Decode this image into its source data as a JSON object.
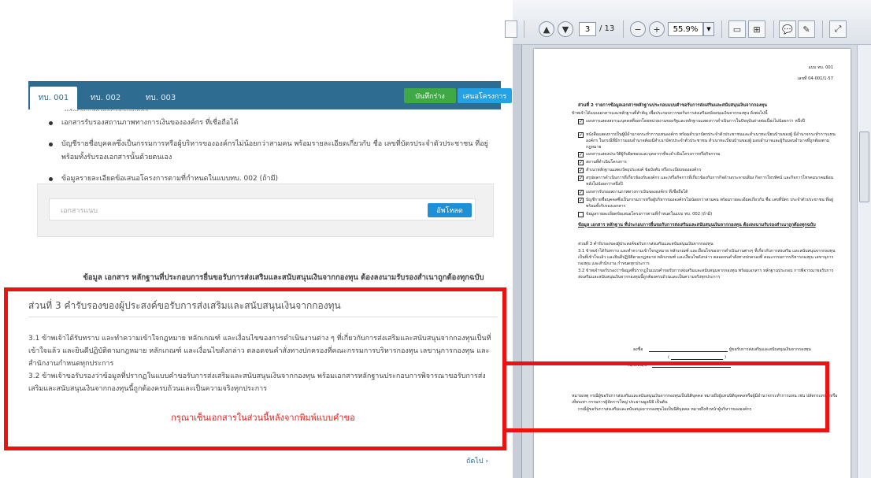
{
  "left": {
    "tabs": [
      "ทบ. 001",
      "ทบ. 002",
      "ทบ. 003"
    ],
    "save_button": "บันทึกร่าง",
    "propose_button": "เสนอโครงการ",
    "cut_line": "หลักฐานแสดงการเป็นนิติบุคคล",
    "bullets": [
      "เอกสารรับรองสถานภาพทางการเงินขององค์กร ที่เชื่อถือได้",
      "บัญชีรายชื่อบุคคลซึ่งเป็นกรรมการหรือผู้บริหารขององค์กรไม่น้อยกว่าสามคน พร้อมรายละเอียดเกี่ยวกับ ชื่อ เลขที่บัตรประจำตัวประชาชน ที่อยู่ พร้อมทั้งรับรองเอกสารนั้นด้วยตนเอง",
      "ข้อมูลรายละเอียดข้อเสนอโครงการตามที่กำหนดในแบบทบ. 002 (ถ้ามี)"
    ],
    "upload_placeholder": "เอกสารแนบ",
    "upload_button": "อัพโหลด",
    "heading": "ข้อมูล เอกสาร หลักฐานที่ประกอบการยื่นขอรับการส่งเสริมและสนับสนุนเงินจากกองทุน ต้องลงนามรับรองสำเนาถูกต้องทุกฉบับ",
    "part3_title": "ส่วนที่ 3 คำรับรองของผู้ประสงค์ขอรับการส่งเสริมและสนับสนุนเงินจากกองทุน",
    "para1": "3.1 ข้าพเจ้าได้รับทราบ และทำความเข้าใจกฎหมาย หลักเกณฑ์ และเงื่อนไขของการดำเนินงานต่าง ๆ ที่เกี่ยวกับการส่งเสริมและสนับสนุนจากกองทุนเป็นที่เข้าใจแล้ว และยินดีปฏิบัติตามกฎหมาย หลักเกณฑ์ และเงื่อนไขดังกล่าว ตลอดจนคำสั่งทางปกครองที่คณะกรรมการบริหารกองทุน เลขานุการกองทุน และสำนักงานกำหนดทุกประการ",
    "para2": "3.2 ข้าพเจ้าขอรับรองว่าข้อมูลที่ปรากฏในแบบคำขอรับการส่งเสริมและสนับสนุนเงินจากกองทุน พร้อมเอกสารหลักฐานประกอบการพิจารณาขอรับการส่งเสริมและสนับสนุนเงินจากกองทุนนี้ถูกต้องครบถ้วนและเป็นความจริงทุกประการ",
    "red_note": "กรุณาเซ็นเอกสารในส่วนนี้หลังจากพิมพ์แบบคำขอ",
    "next_link": "ถัดไป ›"
  },
  "viewer": {
    "current_page": "3",
    "total_pages": "/ 13",
    "zoom": "55.9%"
  },
  "pdf": {
    "form_code": "แบบ ทบ. 001",
    "ref_no": "เลขที่ 04-001/1-57",
    "part2_title": "ส่วนที่ 2 รายการข้อมูลเอกสารหลักฐานประกอบแบบคำขอรับการส่งเสริมและสนับสนุนเงินจากกองทุน",
    "part2_intro": "ข้าพเจ้าได้แนบเอกสารและหลักฐานที่สำคัญ เพื่อประกอบการขอรับการส่งเสริมสนับสนุนเงินจากกองทุน ดังต่อไปนี้",
    "check_items": [
      "เอกสารแสดงสถานะบุคคลที่ออกโดยหน่วยงานของรัฐและหลักฐานแสดงการดำเนินการในปัจจุบันย่างต่อเนื่องไม่น้อยกว่า หนึ่งปี",
      "หนังสือแสดงการเป็นผู้มีอำนาจกระทำการแทนองค์กร พร้อมสำเนาบัตรประจำตัวประชาชนและสำเนาทะเบียนบ้านของผู้ มีอำนาจกระทำการแทนองค์กร ในกรณีที่มีการมอบอำนาจต้องมีสำเนาบัตรประจำตัวประชาชน สำเนาทะเบียนบ้านของผู้ มอบอำนาจและผู้รับมอบอำนาจที่ถูกต้องตามกฎหมาย",
      "เอกสารแสดงประวัติผู้รับผิดชอบและบุคลากรที่จะดำเนินโครงการหรือกิจกรรม",
      "สถานที่ดำเนินโครงการ",
      "สำเนาหลักฐานแสดงวัตถุประสงค์ ข้อบังคับ หรือระเบียบขององค์กร",
      "สรุปผลการดำเนินการที่เกี่ยวข้องกับองค์กร และ/หรือกิจการที่เกี่ยวข้องกับการกิจด้านกระจายเสียง กิจการโทรทัศน์ และกิจการโทรคมนาคมย้อนหลังไม่น้อยกว่าหนึ่งปี",
      "เอกสารรับรองสถานภาพทางการเงินขององค์กร ที่เชื่อถือได้",
      "บัญชีรายชื่อบุคคลซึ่งเป็นกรรมการหรือผู้บริหารขององค์กรไม่น้อยกว่าสามคน พร้อมรายละเอียดเกี่ยวกับ ชื่อ เลขที่บัตร ประจำตัวประชาชน ที่อยู่ พร้อมทั้งรับรองเอกสาร",
      "ข้อมูลรายละเอียดข้อเสนอโครงการตามที่กำหนดในแบบ ทบ. 002 (ถ้ามี)"
    ],
    "underlined_note": "ข้อมูล เอกสาร หลักฐาน ที่ประกอบการยื่นขอรับการส่งเสริมและสนับสนุนเงินจากกองทุน ต้องลงนามรับรองสำเนาถูกต้องทุกฉบับ",
    "part3_title": "ส่วนที่ 3 คำรับรองของผู้ประสงค์ขอรับการส่งเสริมและสนับสนุนเงินจากกองทุน",
    "part3_p1": "3.1 ข้าพเจ้าได้รับทราบ และทำความเข้าใจกฎหมาย หลักเกณฑ์ และเงื่อนไขของการดำเนินงานต่างๆ ที่เกี่ยวกับการส่งเสริม และสนับสนุนจากกองทุนเป็นที่เข้าใจแล้ว และยินดีปฏิบัติตามกฎหมาย หลักเกณฑ์ และเงื่อนไขดังกล่าว ตลอดจนคำสั่งทางปกครองที่ คณะกรรมการบริหารกองทุน เลขานุการกองทุน และสำนักงาน กำหนดทุกประการ",
    "part3_p2": "3.2 ข้าพเจ้าขอรับรองว่าข้อมูลที่ปรากฏในแบบคำขอรับการส่งเสริมและสนับสนุนจากกองทุน พร้อมเอกสาร หลักฐานประกอบ การพิจารณาขอรับการส่งเสริมและสนับสนุนเงินจากกองทุนนี้ถูกต้องครบถ้วนและเป็นความจริงทุกประการ",
    "sign_label": "ลงชื่อ",
    "sign_role": "ผู้ขอรับการส่งเสริมและสนับสนุนเงินจากกองทุน",
    "paren_open": "(",
    "paren_close": ")",
    "date_label": "วัน/เดือน/ปี",
    "remark": "หมายเหตุ กรณีผู้ขอรับการส่งเสริมและสนับสนุนเงินจากกองทุนเป็นนิติบุคคล หมายถึงผู้แทนนิติบุคคลหรือผู้มีอำนาจกระทำการแทน เช่น ปลัดกระทรวงหรือเทียบเท่า กรรมการผู้จัดการใหญ่ ประธานมูลนิธิ เป็นต้น",
    "remark2": "กรณีผู้ขอรับการส่งเสริมและสนับสนุนจากกองทุนไม่เป็นนิติบุคคล หมายถึงหัวหน้าผู้บริหารขององค์กร"
  }
}
